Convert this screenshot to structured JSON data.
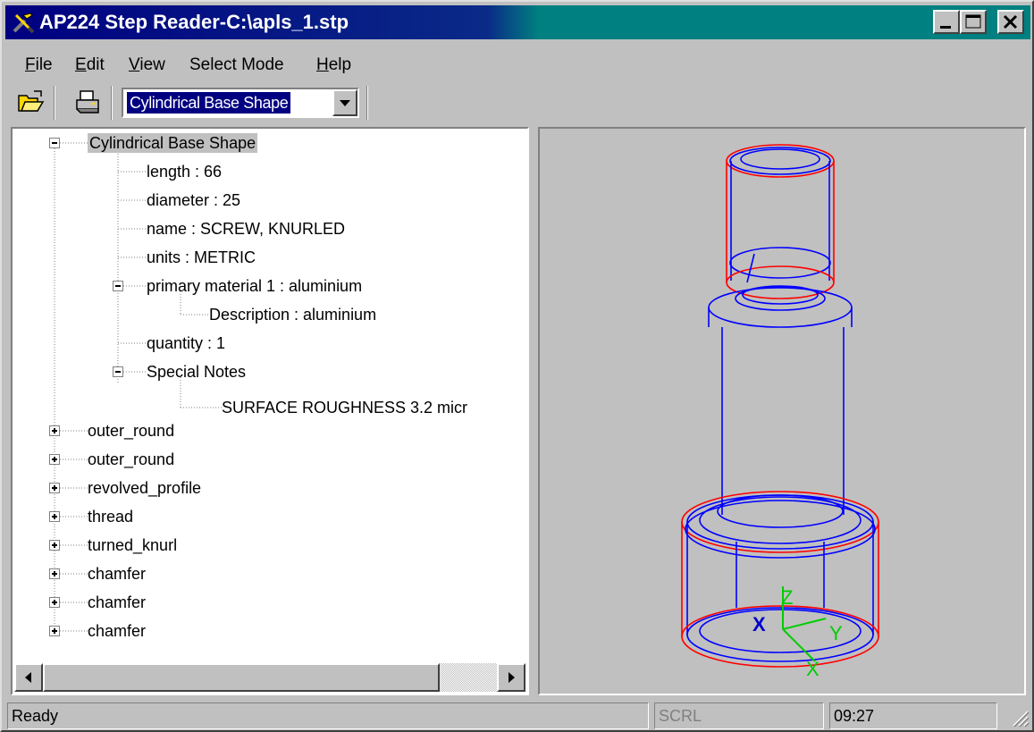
{
  "window": {
    "title": "AP224 Step Reader-C:\\apls_1.stp",
    "icon": "tools-icon",
    "controls": [
      "minimize-icon",
      "maximize-icon",
      "close-icon"
    ]
  },
  "menu": [
    {
      "label": "File",
      "accel": "F",
      "rest": "ile"
    },
    {
      "label": "Edit",
      "accel": "E",
      "rest": "dit"
    },
    {
      "label": "View",
      "accel": "V",
      "rest": "iew"
    },
    {
      "label": "Select Mode",
      "accel": "",
      "rest": "Select Mode"
    },
    {
      "label": "Help",
      "accel": "H",
      "rest": "elp"
    }
  ],
  "toolbar": {
    "open_icon": "open-folder-icon",
    "print_icon": "printer-icon",
    "feature_select_value": "Cylindrical Base Shape"
  },
  "tree": {
    "root": "Cylindrical Base Shape",
    "attributes": [
      "length : 66",
      "diameter : 25",
      "name : SCREW, KNURLED",
      "units : METRIC"
    ],
    "material": "primary material 1 : aluminium",
    "material_description": "Description : aluminium",
    "quantity": "quantity : 1",
    "special_notes": "Special Notes",
    "special_note_text": "SURFACE ROUGHNESS 3.2 micr",
    "features": [
      "outer_round",
      "outer_round",
      "revolved_profile",
      "thread",
      "turned_knurl",
      "chamfer",
      "chamfer",
      "chamfer"
    ]
  },
  "viewport": {
    "axis_labels": [
      "Z",
      "X",
      "Y",
      "X"
    ],
    "colors": {
      "outline": "#ff0000",
      "edges": "#0000ff",
      "axes": "#00cc00"
    }
  },
  "status": {
    "message": "Ready",
    "scroll_lock": "SCRL",
    "time": "09:27"
  }
}
